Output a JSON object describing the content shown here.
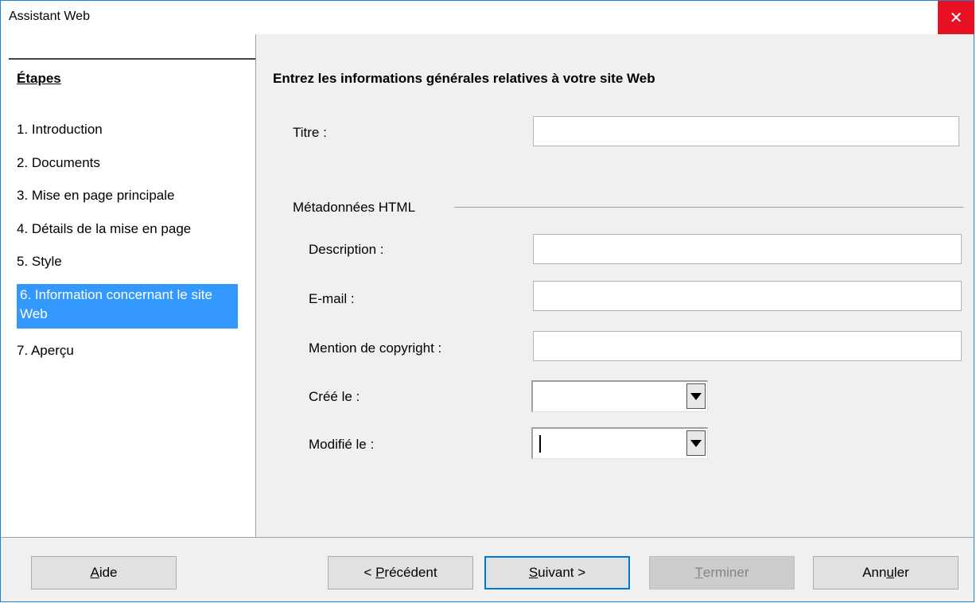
{
  "window": {
    "title": "Assistant Web",
    "close_symbol": "✕"
  },
  "sidebar": {
    "heading": "Étapes",
    "steps": [
      {
        "label": "1. Introduction"
      },
      {
        "label": "2. Documents"
      },
      {
        "label": "3. Mise en page principale"
      },
      {
        "label": "4. Détails de la mise en page"
      },
      {
        "label": "5. Style"
      },
      {
        "label": "6. Information concernant le site Web",
        "selected": true
      },
      {
        "label": "7. Aperçu"
      }
    ],
    "selected_color": "#3399ff"
  },
  "main": {
    "heading": "Entrez les informations générales relatives à votre site Web",
    "title_label": "Titre :",
    "title_value": "",
    "metadata_group": "Métadonnées HTML",
    "description_label": "Description :",
    "description_value": "",
    "email_label": "E-mail :",
    "email_value": "",
    "copyright_label": "Mention de copyright :",
    "copyright_value": "",
    "created_label": "Créé le :",
    "created_value": "",
    "modified_label": "Modifié le :",
    "modified_value": ""
  },
  "footer": {
    "help": {
      "pre": "",
      "mnemonic": "A",
      "post": "ide"
    },
    "previous": {
      "pre": "< ",
      "mnemonic": "P",
      "post": "récédent"
    },
    "next": {
      "pre": "",
      "mnemonic": "S",
      "post": "uivant >"
    },
    "finish": {
      "pre": "",
      "mnemonic": "T",
      "post": "erminer"
    },
    "cancel": {
      "pre": "Ann",
      "mnemonic": "u",
      "post": "ler"
    }
  },
  "colors": {
    "accent": "#0078d7",
    "close": "#e81123"
  }
}
